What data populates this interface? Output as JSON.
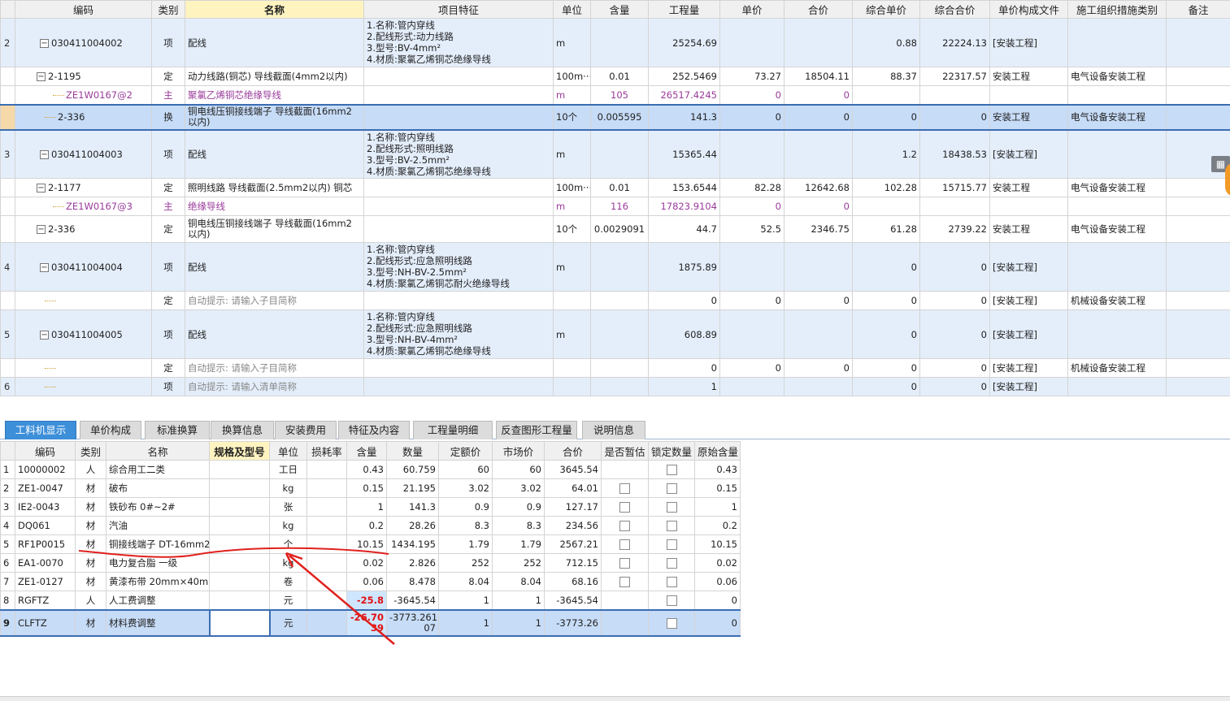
{
  "top_headers": [
    "",
    "编码",
    "类别",
    "名称",
    "项目特征",
    "单位",
    "含量",
    "工程量",
    "单价",
    "合价",
    "综合单价",
    "综合合价",
    "单价构成文件",
    "施工组织措施类别",
    "备注"
  ],
  "top_rows": [
    {
      "type": "item",
      "num": "2",
      "code": "030411004002",
      "kind": "项",
      "name": "配线",
      "features": [
        "1.名称:管内穿线",
        "2.配线形式:动力线路",
        "3.型号:BV-4mm²",
        "4.材质:聚氯乙烯铜芯绝缘导线"
      ],
      "unit": "m",
      "content": "",
      "qty": "25254.69",
      "price": "",
      "total": "",
      "unit_comp": "0.88",
      "total_comp": "22224.13",
      "file": "[安装工程]",
      "cat": "",
      "note": ""
    },
    {
      "type": "sub",
      "num": "",
      "code": "2-1195",
      "kind": "定",
      "name": "动力线路(铜芯) 导线截面(4mm2以内)",
      "features": [],
      "unit": "100m···",
      "content": "0.01",
      "qty": "252.5469",
      "price": "73.27",
      "total": "18504.11",
      "unit_comp": "88.37",
      "total_comp": "22317.57",
      "file": "安装工程",
      "cat": "电气设备安装工程",
      "note": ""
    },
    {
      "type": "main",
      "num": "",
      "code": "ZE1W0167@2",
      "kind": "主",
      "name": "聚氯乙烯铜芯绝缘导线",
      "features": [],
      "unit": "m",
      "content": "105",
      "qty": "26517.4245",
      "price": "0",
      "total": "0",
      "unit_comp": "",
      "total_comp": "",
      "file": "",
      "cat": "",
      "note": ""
    },
    {
      "type": "sel",
      "num": "",
      "code": "2-336",
      "kind": "换",
      "name": "铜电线压铜接线端子 导线截面(16mm2以内)",
      "features": [],
      "unit": "10个",
      "content": "0.005595",
      "qty": "141.3",
      "price": "0",
      "total": "0",
      "unit_comp": "0",
      "total_comp": "0",
      "file": "安装工程",
      "cat": "电气设备安装工程",
      "note": ""
    },
    {
      "type": "item",
      "num": "3",
      "code": "030411004003",
      "kind": "项",
      "name": "配线",
      "features": [
        "1.名称:管内穿线",
        "2.配线形式:照明线路",
        "3.型号:BV-2.5mm²",
        "4.材质:聚氯乙烯铜芯绝缘导线"
      ],
      "unit": "m",
      "content": "",
      "qty": "15365.44",
      "price": "",
      "total": "",
      "unit_comp": "1.2",
      "total_comp": "18438.53",
      "file": "[安装工程]",
      "cat": "",
      "note": ""
    },
    {
      "type": "sub",
      "num": "",
      "code": "2-1177",
      "kind": "定",
      "name": "照明线路 导线截面(2.5mm2以内) 铜芯",
      "features": [],
      "unit": "100m···",
      "content": "0.01",
      "qty": "153.6544",
      "price": "82.28",
      "total": "12642.68",
      "unit_comp": "102.28",
      "total_comp": "15715.77",
      "file": "安装工程",
      "cat": "电气设备安装工程",
      "note": ""
    },
    {
      "type": "main",
      "num": "",
      "code": "ZE1W0167@3",
      "kind": "主",
      "name": "绝缘导线",
      "features": [],
      "unit": "m",
      "content": "116",
      "qty": "17823.9104",
      "price": "0",
      "total": "0",
      "unit_comp": "",
      "total_comp": "",
      "file": "",
      "cat": "",
      "note": ""
    },
    {
      "type": "sub",
      "num": "",
      "code": "2-336",
      "kind": "定",
      "name": "铜电线压铜接线端子 导线截面(16mm2以内)",
      "features": [],
      "unit": "10个",
      "content": "0.0029091",
      "qty": "44.7",
      "price": "52.5",
      "total": "2346.75",
      "unit_comp": "61.28",
      "total_comp": "2739.22",
      "file": "安装工程",
      "cat": "电气设备安装工程",
      "note": ""
    },
    {
      "type": "item",
      "num": "4",
      "code": "030411004004",
      "kind": "项",
      "name": "配线",
      "features": [
        "1.名称:管内穿线",
        "2.配线形式:应急照明线路",
        "3.型号:NH-BV-2.5mm²",
        "4.材质:聚氯乙烯铜芯耐火绝缘导线"
      ],
      "unit": "m",
      "content": "",
      "qty": "1875.89",
      "price": "",
      "total": "",
      "unit_comp": "0",
      "total_comp": "0",
      "file": "[安装工程]",
      "cat": "",
      "note": ""
    },
    {
      "type": "sub",
      "num": "",
      "code": "",
      "kind": "定",
      "name": "自动提示: 请输入子目简称",
      "features": [],
      "unit": "",
      "content": "",
      "qty": "0",
      "price": "0",
      "total": "0",
      "unit_comp": "0",
      "total_comp": "0",
      "file": "[安装工程]",
      "cat": "机械设备安装工程",
      "note": ""
    },
    {
      "type": "item",
      "num": "5",
      "code": "030411004005",
      "kind": "项",
      "name": "配线",
      "features": [
        "1.名称:管内穿线",
        "2.配线形式:应急照明线路",
        "3.型号:NH-BV-4mm²",
        "4.材质:聚氯乙烯铜芯绝缘导线"
      ],
      "unit": "m",
      "content": "",
      "qty": "608.89",
      "price": "",
      "total": "",
      "unit_comp": "0",
      "total_comp": "0",
      "file": "[安装工程]",
      "cat": "",
      "note": ""
    },
    {
      "type": "sub",
      "num": "",
      "code": "",
      "kind": "定",
      "name": "自动提示: 请输入子目简称",
      "features": [],
      "unit": "",
      "content": "",
      "qty": "0",
      "price": "0",
      "total": "0",
      "unit_comp": "0",
      "total_comp": "0",
      "file": "[安装工程]",
      "cat": "机械设备安装工程",
      "note": ""
    },
    {
      "type": "item6",
      "num": "6",
      "code": "",
      "kind": "项",
      "name": "自动提示: 请输入清单简称",
      "features": [],
      "unit": "",
      "content": "",
      "qty": "1",
      "price": "",
      "total": "",
      "unit_comp": "0",
      "total_comp": "0",
      "file": "[安装工程]",
      "cat": "",
      "note": ""
    }
  ],
  "tabs": [
    "工料机显示",
    "单价构成",
    "标准换算",
    "换算信息",
    "安装费用",
    "特征及内容",
    "工程量明细",
    "反查图形工程量",
    "说明信息"
  ],
  "bottom_headers": [
    "",
    "编码",
    "类别",
    "名称",
    "规格及型号",
    "单位",
    "损耗率",
    "含量",
    "数量",
    "定额价",
    "市场价",
    "合价",
    "是否暂估",
    "锁定数量",
    "原始含量"
  ],
  "bottom_rows": [
    {
      "num": "1",
      "code": "10000002",
      "kind": "人",
      "name": "综合用工二类",
      "spec": "",
      "unit": "工日",
      "loss": "",
      "content": "0.43",
      "qty": "60.759",
      "base": "60",
      "market": "60",
      "total": "3645.54",
      "est": false,
      "lock": true,
      "orig": "0.43"
    },
    {
      "num": "2",
      "code": "ZE1-0047",
      "kind": "材",
      "name": "破布",
      "spec": "",
      "unit": "kg",
      "loss": "",
      "content": "0.15",
      "qty": "21.195",
      "base": "3.02",
      "market": "3.02",
      "total": "64.01",
      "est": true,
      "lock": true,
      "orig": "0.15"
    },
    {
      "num": "3",
      "code": "IE2-0043",
      "kind": "材",
      "name": "铁砂布 0#~2#",
      "spec": "",
      "unit": "张",
      "loss": "",
      "content": "1",
      "qty": "141.3",
      "base": "0.9",
      "market": "0.9",
      "total": "127.17",
      "est": true,
      "lock": true,
      "orig": "1"
    },
    {
      "num": "4",
      "code": "DQ061",
      "kind": "材",
      "name": "汽油",
      "spec": "",
      "unit": "kg",
      "loss": "",
      "content": "0.2",
      "qty": "28.26",
      "base": "8.3",
      "market": "8.3",
      "total": "234.56",
      "est": true,
      "lock": true,
      "orig": "0.2"
    },
    {
      "num": "5",
      "code": "RF1P0015",
      "kind": "材",
      "name": "铜接线端子 DT-16mm2",
      "spec": "",
      "unit": "个",
      "loss": "",
      "content": "10.15",
      "qty": "1434.195",
      "base": "1.79",
      "market": "1.79",
      "total": "2567.21",
      "est": true,
      "lock": true,
      "orig": "10.15"
    },
    {
      "num": "6",
      "code": "EA1-0070",
      "kind": "材",
      "name": "电力复合脂 一级",
      "spec": "",
      "unit": "kg",
      "loss": "",
      "content": "0.02",
      "qty": "2.826",
      "base": "252",
      "market": "252",
      "total": "712.15",
      "est": true,
      "lock": true,
      "orig": "0.02"
    },
    {
      "num": "7",
      "code": "ZE1-0127",
      "kind": "材",
      "name": "黄漆布带 20mm×40m",
      "spec": "",
      "unit": "卷",
      "loss": "",
      "content": "0.06",
      "qty": "8.478",
      "base": "8.04",
      "market": "8.04",
      "total": "68.16",
      "est": true,
      "lock": true,
      "orig": "0.06"
    },
    {
      "num": "8",
      "code": "RGFTZ",
      "kind": "人",
      "name": "人工费调整",
      "spec": "",
      "unit": "元",
      "loss": "",
      "content": "-25.8",
      "qty": "-3645.54",
      "base": "1",
      "market": "1",
      "total": "-3645.54",
      "est": false,
      "lock": true,
      "orig": "0"
    },
    {
      "num": "9",
      "code": "CLFTZ",
      "kind": "材",
      "name": "材料费调整",
      "spec": "",
      "unit": "元",
      "loss": "",
      "content": "-26.70\n39",
      "qty": "-3773.261\n07",
      "base": "1",
      "market": "1",
      "total": "-3773.26",
      "est": false,
      "lock": true,
      "orig": "0"
    }
  ],
  "side_tab_icon": "grid-icon",
  "colors": {
    "accent": "#3d8fd9",
    "selection": "#c7dcf7",
    "item_row": "#e4eefb",
    "main_material": "#9a3a9a",
    "annotation": "#e0201c"
  }
}
